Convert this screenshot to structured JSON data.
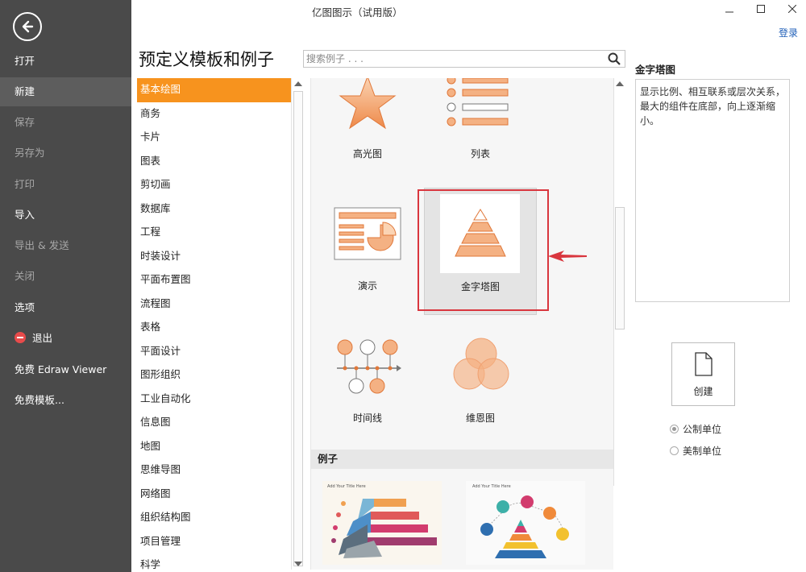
{
  "window": {
    "title": "亿图图示（试用版）",
    "login": "登录"
  },
  "sidebar": {
    "items": [
      {
        "label": "打开"
      },
      {
        "label": "新建"
      },
      {
        "label": "保存"
      },
      {
        "label": "另存为"
      },
      {
        "label": "打印"
      },
      {
        "label": "导入"
      },
      {
        "label": "导出 & 发送"
      },
      {
        "label": "关闭"
      },
      {
        "label": "选项"
      },
      {
        "label": "退出"
      },
      {
        "label": "免费 Edraw Viewer"
      },
      {
        "label": "免费模板..."
      }
    ],
    "active": "新建"
  },
  "main": {
    "heading": "预定义模板和例子",
    "search_placeholder": "搜索例子 . . ."
  },
  "categories": [
    "基本绘图",
    "商务",
    "卡片",
    "图表",
    "剪切画",
    "数据库",
    "工程",
    "时装设计",
    "平面布置图",
    "流程图",
    "表格",
    "平面设计",
    "图形组织",
    "工业自动化",
    "信息图",
    "地图",
    "思维导图",
    "网络图",
    "组织结构图",
    "项目管理",
    "科学"
  ],
  "active_category": "基本绘图",
  "templates": [
    {
      "label": "高光图",
      "icon": "star-icon"
    },
    {
      "label": "列表",
      "icon": "list-icon"
    },
    {
      "label": "演示",
      "icon": "presentation-icon"
    },
    {
      "label": "金字塔图",
      "icon": "pyramid-icon",
      "selected": true
    },
    {
      "label": "时间线",
      "icon": "timeline-icon"
    },
    {
      "label": "维恩图",
      "icon": "venn-icon"
    }
  ],
  "examples": {
    "header": "例子",
    "items": [
      {
        "caption": "Add Your Title Here"
      },
      {
        "caption": "Add Your Title Here"
      }
    ]
  },
  "details": {
    "title": "金字塔图",
    "description": "显示比例、相互联系或层次关系，最大的组件在底部，向上逐渐缩小。",
    "create_label": "创建",
    "units": [
      {
        "label": "公制单位",
        "checked": true
      },
      {
        "label": "美制单位",
        "checked": false
      }
    ]
  },
  "colors": {
    "accent": "#f7931e",
    "sidebar_bg": "#4a4a4a",
    "highlight": "#d9363e",
    "shape_fill": "#f4b183",
    "shape_stroke": "#e0783a"
  }
}
